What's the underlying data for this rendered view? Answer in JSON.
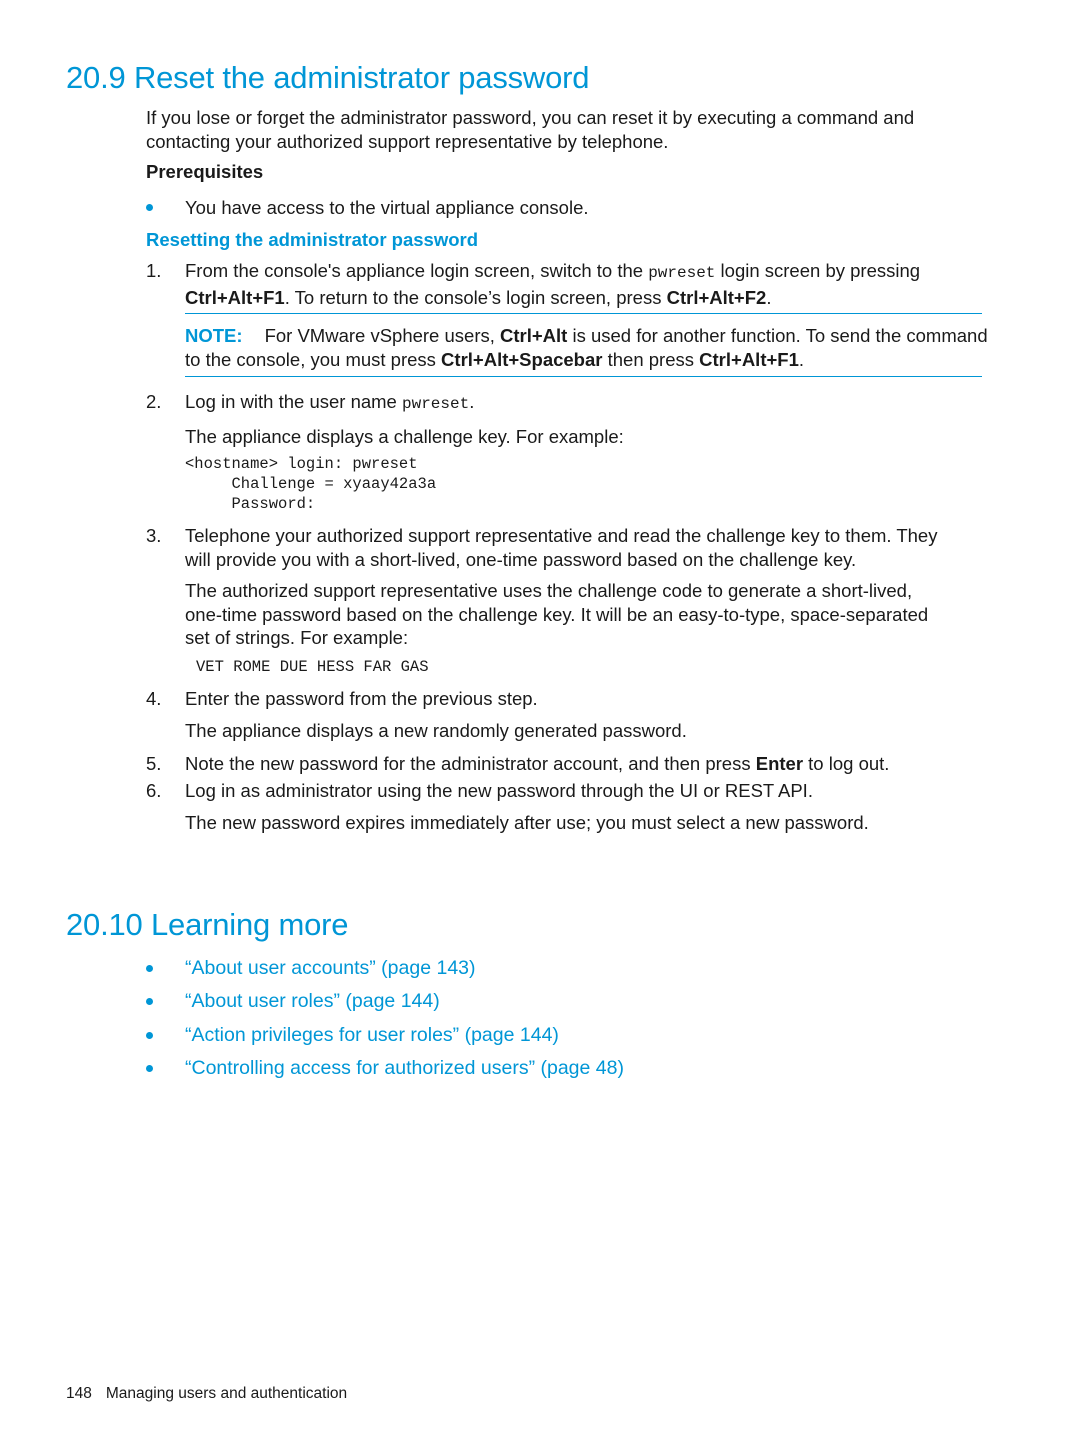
{
  "section_reset": {
    "heading": "20.9 Reset the administrator password",
    "intro_line1": "If you lose or forget the administrator password, you can reset it by executing a command and",
    "intro_line2": "contacting your authorized support representative by telephone.",
    "prerequisites_label": "Prerequisites",
    "prerequisite_item": "You have access to the virtual appliance console.",
    "procedure_title": "Resetting the administrator password",
    "steps": [
      {
        "number": "1.",
        "line1_a": "From the console's appliance login screen, switch to the ",
        "line1_code": "pwreset",
        "line1_b": " login screen by pressing",
        "line2_key1": "Ctrl+Alt+F1",
        "line2_mid": ". To return to the console’s login screen, press ",
        "line2_key2": "Ctrl+Alt+F2",
        "line2_end": "."
      },
      {
        "number": "2.",
        "text": "Log in with the user name ",
        "code": "pwreset",
        "end": ".",
        "followup": "The appliance displays a challenge key. For example:",
        "code_block": "<hostname> login: pwreset\n     Challenge = xyaay42a3a\n     Password:"
      },
      {
        "number": "3.",
        "line1": "Telephone your authorized support representative and read the challenge key to them. They",
        "line2": "will provide you with a short-lived, one-time password based on the challenge key.",
        "para_line1": "The authorized support representative uses the challenge code to generate a short-lived,",
        "para_line2": "one-time password based on the challenge key. It will be an easy-to-type, space-separated",
        "para_line3": "set of strings. For example:",
        "code_example": "VET ROME DUE HESS FAR GAS"
      },
      {
        "number": "4.",
        "text": "Enter the password from the previous step.",
        "followup": "The appliance displays a new randomly generated password."
      },
      {
        "number": "5.",
        "text_a": "Note the new password for the administrator account, and then press ",
        "key": "Enter",
        "text_b": " to log out."
      },
      {
        "number": "6.",
        "text": "Log in as administrator using the new password through the UI or REST API.",
        "followup": "The new password expires immediately after use; you must select a new password."
      }
    ],
    "note": {
      "label": "NOTE:",
      "line1_a": "For VMware vSphere users, ",
      "line1_key": "Ctrl+Alt",
      "line1_b": " is used for another function. To send the command",
      "line2_a": "to the console, you must press ",
      "line2_key1": "Ctrl+Alt+Spacebar",
      "line2_mid": " then press ",
      "line2_key2": "Ctrl+Alt+F1",
      "line2_end": "."
    }
  },
  "section_learning": {
    "heading": "20.10 Learning more",
    "links": [
      "“About user accounts” (page 143)",
      "“About user roles” (page 144)",
      "“Action privileges for user roles” (page 144)",
      "“Controlling access for authorized users” (page 48)"
    ]
  },
  "footer": {
    "page_number": "148",
    "chapter_title": "Managing users and authentication"
  },
  "colors": {
    "accent": "#0096d6",
    "text": "#1a1a1a"
  }
}
